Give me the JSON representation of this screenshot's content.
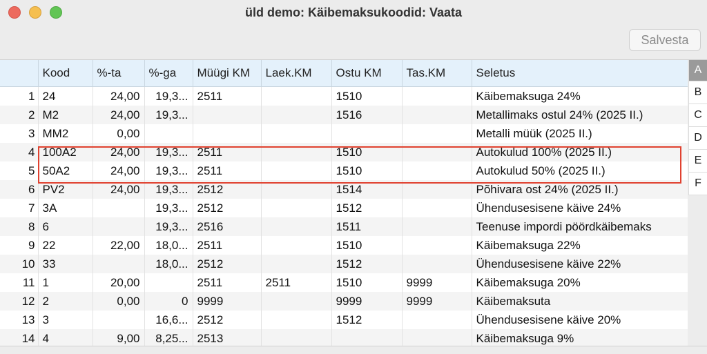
{
  "window": {
    "title": "üld demo: Käibemaksukoodid: Vaata"
  },
  "toolbar": {
    "save_label": "Salvesta"
  },
  "table": {
    "columns": [
      "",
      "Kood",
      "%-ta",
      "%-ga",
      "Müügi KM",
      "Laek.KM",
      "Ostu KM",
      "Tas.KM",
      "Seletus"
    ],
    "rows": [
      [
        "1",
        "24",
        "24,00",
        "19,3...",
        "2511",
        "",
        "1510",
        "",
        "Käibemaksuga 24%"
      ],
      [
        "2",
        "M2",
        "24,00",
        "19,3...",
        "",
        "",
        "1516",
        "",
        "Metallimaks ostul 24% (2025 II.)"
      ],
      [
        "3",
        "MM2",
        "0,00",
        "",
        "",
        "",
        "",
        "",
        "Metalli müük (2025 II.)"
      ],
      [
        "4",
        "100A2",
        "24,00",
        "19,3...",
        "2511",
        "",
        "1510",
        "",
        "Autokulud 100% (2025 II.)"
      ],
      [
        "5",
        "50A2",
        "24,00",
        "19,3...",
        "2511",
        "",
        "1510",
        "",
        "Autokulud 50% (2025 II.)"
      ],
      [
        "6",
        "PV2",
        "24,00",
        "19,3...",
        "2512",
        "",
        "1514",
        "",
        "Põhivara ost 24% (2025 II.)"
      ],
      [
        "7",
        "3A",
        "",
        "19,3...",
        "2512",
        "",
        "1512",
        "",
        "Ühendusesisene käive 24%"
      ],
      [
        "8",
        "6",
        "",
        "19,3...",
        "2516",
        "",
        "1511",
        "",
        "Teenuse impordi pöördkäibemaks"
      ],
      [
        "9",
        "22",
        "22,00",
        "18,0...",
        "2511",
        "",
        "1510",
        "",
        "Käibemaksuga 22%"
      ],
      [
        "10",
        "33",
        "",
        "18,0...",
        "2512",
        "",
        "1512",
        "",
        "Ühendusesisene käive 22%"
      ],
      [
        "11",
        "1",
        "20,00",
        "",
        "2511",
        "2511",
        "1510",
        "9999",
        "Käibemaksuga 20%"
      ],
      [
        "12",
        "2",
        "0,00",
        "0",
        "9999",
        "",
        "9999",
        "9999",
        "Käibemaksuta"
      ],
      [
        "13",
        "3",
        "",
        "16,6...",
        "2512",
        "",
        "1512",
        "",
        "Ühendusesisene käive 20%"
      ],
      [
        "14",
        "4",
        "9,00",
        "8,25...",
        "2513",
        "",
        "",
        "",
        "Käibemaksuga 9%"
      ]
    ]
  },
  "alpha_index": [
    "A",
    "B",
    "C",
    "D",
    "E",
    "F"
  ],
  "alpha_active": "A",
  "highlight_color": "#e0412f"
}
